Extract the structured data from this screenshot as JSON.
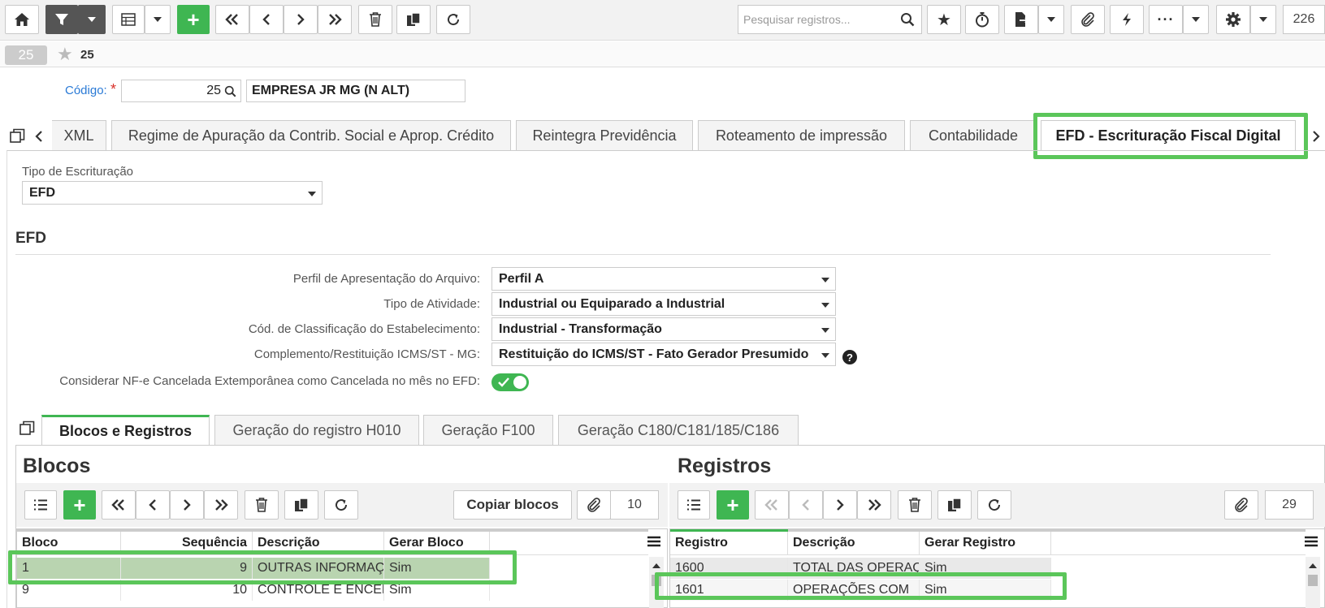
{
  "toolbar": {
    "search_placeholder": "Pesquisar registros...",
    "record_count": "226"
  },
  "nav": {
    "pill": "25",
    "fav_count": "25"
  },
  "form": {
    "codigo_label": "Código:",
    "required_mark": "*",
    "codigo_value": "25",
    "empresa_name": "EMPRESA JR MG (N ALT)"
  },
  "tabs": [
    {
      "label": "XML"
    },
    {
      "label": "Regime de Apuração da Contrib. Social e Aprop. Crédito"
    },
    {
      "label": "Reintegra Previdência"
    },
    {
      "label": "Roteamento de impressão"
    },
    {
      "label": "Contabilidade"
    },
    {
      "label": "EFD - Escrituração Fiscal Digital"
    }
  ],
  "escrituracao": {
    "label": "Tipo de Escrituração",
    "value": "EFD"
  },
  "efd": {
    "section_title": "EFD",
    "fields": [
      {
        "label": "Perfil de Apresentação do Arquivo:",
        "value": "Perfil A"
      },
      {
        "label": "Tipo de Atividade:",
        "value": "Industrial ou Equiparado a Industrial"
      },
      {
        "label": "Cód. de Classificação do Estabelecimento:",
        "value": "Industrial - Transformação"
      },
      {
        "label": "Complemento/Restituição ICMS/ST - MG:",
        "value": "Restituição do ICMS/ST - Fato Gerador Presumido"
      }
    ],
    "toggle_label": "Considerar NF-e Cancelada Extemporânea como Cancelada no mês no EFD:"
  },
  "subtabs": [
    {
      "label": "Blocos e Registros"
    },
    {
      "label": "Geração do registro H010"
    },
    {
      "label": "Geração F100"
    },
    {
      "label": "Geração C180/C181/185/C186"
    }
  ],
  "blocos": {
    "title": "Blocos",
    "copy_button": "Copiar blocos",
    "count": "10",
    "columns": [
      "Bloco",
      "Sequência",
      "Descrição",
      "Gerar Bloco"
    ],
    "rows": [
      [
        "1",
        "9",
        "OUTRAS INFORMAÇÕES",
        "Sim"
      ],
      [
        "9",
        "10",
        "CONTROLE E ENCERRAMENTO",
        "Sim"
      ]
    ]
  },
  "registros": {
    "title": "Registros",
    "count": "29",
    "columns": [
      "Registro",
      "Descrição",
      "Gerar Registro"
    ],
    "rows": [
      [
        "1600",
        "TOTAL DAS OPERAÇÕES",
        "Sim"
      ],
      [
        "1601",
        "OPERAÇÕES COM",
        "Sim"
      ]
    ]
  },
  "colors": {
    "accent_green": "#3fb652",
    "highlight_green": "#5bc65a",
    "link_blue": "#2a7ad6"
  }
}
